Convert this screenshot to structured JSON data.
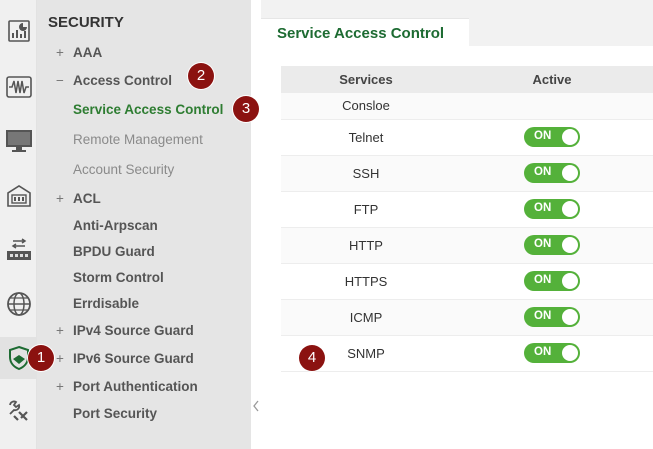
{
  "rail": {
    "items": [
      {
        "icon": "dashboard-icon"
      },
      {
        "icon": "waveform-icon"
      },
      {
        "icon": "monitor-icon"
      },
      {
        "icon": "device-icon"
      },
      {
        "icon": "switch-ports-icon"
      },
      {
        "icon": "globe-icon"
      },
      {
        "icon": "security-shield-icon"
      },
      {
        "icon": "tools-icon"
      }
    ]
  },
  "menu": {
    "title": "SECURITY",
    "items": [
      {
        "sign": "+",
        "label": "AAA"
      },
      {
        "sign": "−",
        "label": "Access Control"
      },
      {
        "sign": "",
        "label": "Service Access Control"
      },
      {
        "sign": "",
        "label": "Remote Management"
      },
      {
        "sign": "",
        "label": "Account Security"
      },
      {
        "sign": "+",
        "label": "ACL"
      },
      {
        "sign": "",
        "label": "Anti-Arpscan"
      },
      {
        "sign": "",
        "label": "BPDU Guard"
      },
      {
        "sign": "",
        "label": "Storm Control"
      },
      {
        "sign": "",
        "label": "Errdisable"
      },
      {
        "sign": "+",
        "label": "IPv4 Source Guard"
      },
      {
        "sign": "+",
        "label": "IPv6 Source Guard"
      },
      {
        "sign": "+",
        "label": "Port Authentication"
      },
      {
        "sign": "",
        "label": "Port Security"
      }
    ]
  },
  "page": {
    "tab_title": "Service Access Control"
  },
  "table": {
    "headers": [
      "Services",
      "Active"
    ],
    "rows": [
      {
        "service": "Consloe",
        "active": ""
      },
      {
        "service": "Telnet",
        "active": "ON"
      },
      {
        "service": "SSH",
        "active": "ON"
      },
      {
        "service": "FTP",
        "active": "ON"
      },
      {
        "service": "HTTP",
        "active": "ON"
      },
      {
        "service": "HTTPS",
        "active": "ON"
      },
      {
        "service": "ICMP",
        "active": "ON"
      },
      {
        "service": "SNMP",
        "active": "ON"
      }
    ]
  },
  "badges": [
    "1",
    "2",
    "3",
    "4"
  ],
  "colors": {
    "accent_green": "#2e7d32",
    "toggle_on": "#54b13a",
    "badge": "#8b1210"
  }
}
